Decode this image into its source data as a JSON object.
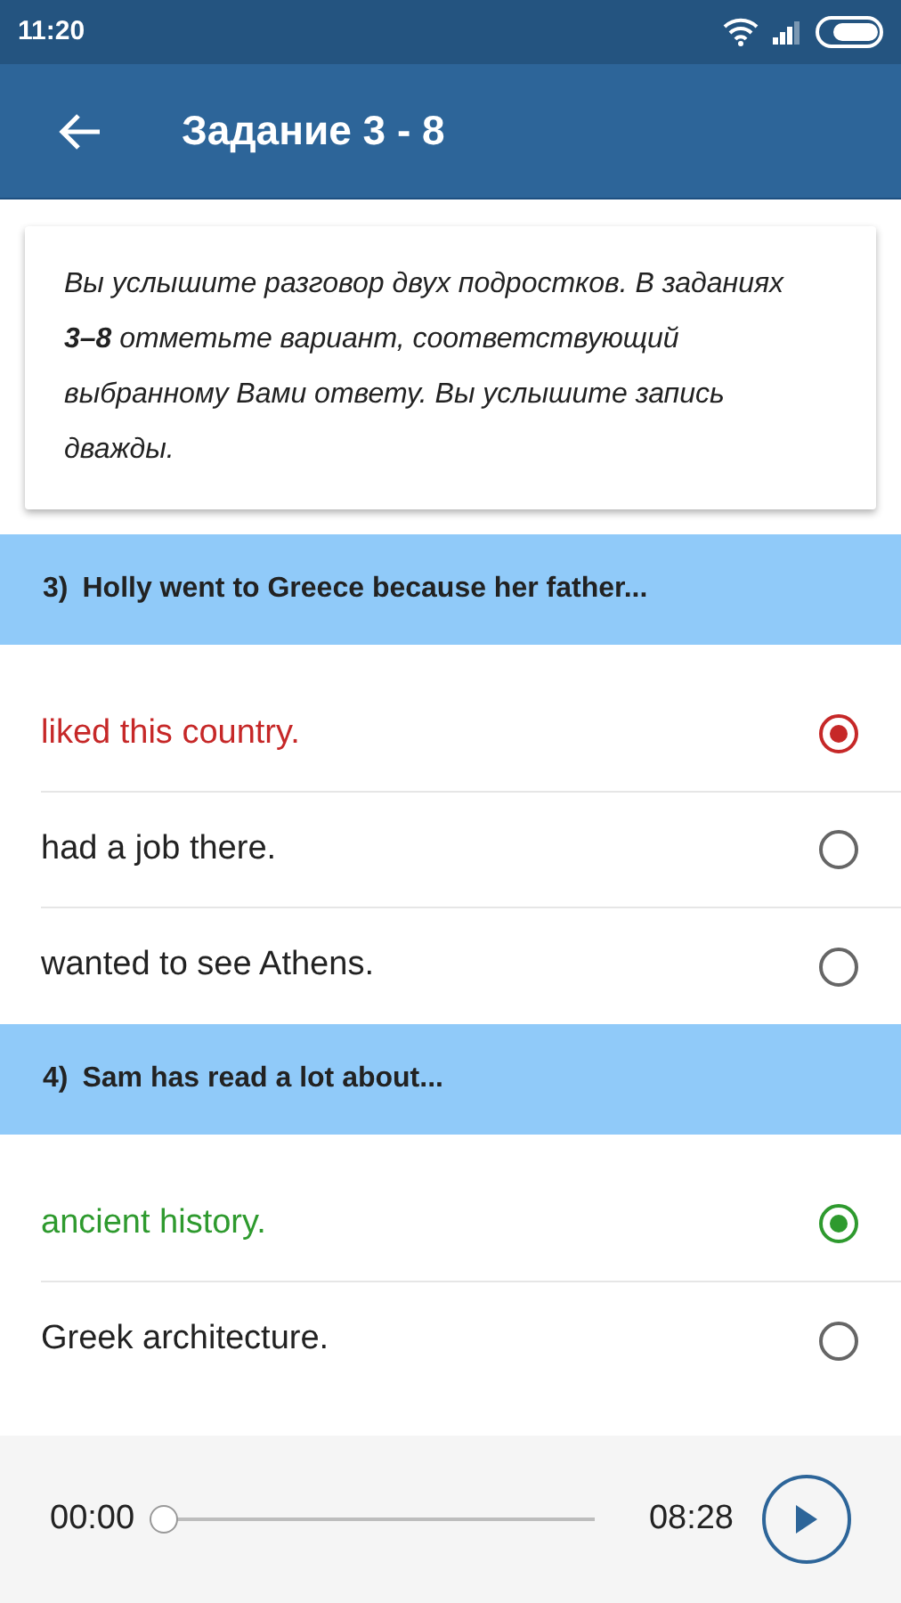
{
  "status_bar": {
    "time": "11:20"
  },
  "app_bar": {
    "title": "Задание 3 - 8"
  },
  "instructions": "Вы услышите разговор двух подростков. В заданиях **3–8** отметьте вариант, соответствующий выбранному Вами ответу. Вы услышите запись дважды.",
  "questions": [
    {
      "number": "3)",
      "text": "Holly went to Greece because her father...",
      "options": [
        {
          "text": "liked this country.",
          "selected": true,
          "color": "#c62828"
        },
        {
          "text": "had a job there.",
          "selected": false
        },
        {
          "text": "wanted to see Athens.",
          "selected": false
        }
      ]
    },
    {
      "number": "4)",
      "text": "Sam has read a lot about...",
      "options": [
        {
          "text": "ancient history.",
          "selected": true,
          "color": "#2e9a2e"
        },
        {
          "text": "Greek architecture.",
          "selected": false
        }
      ]
    }
  ],
  "player": {
    "elapsed": "00:00",
    "duration": "08:28",
    "level": 0
  }
}
